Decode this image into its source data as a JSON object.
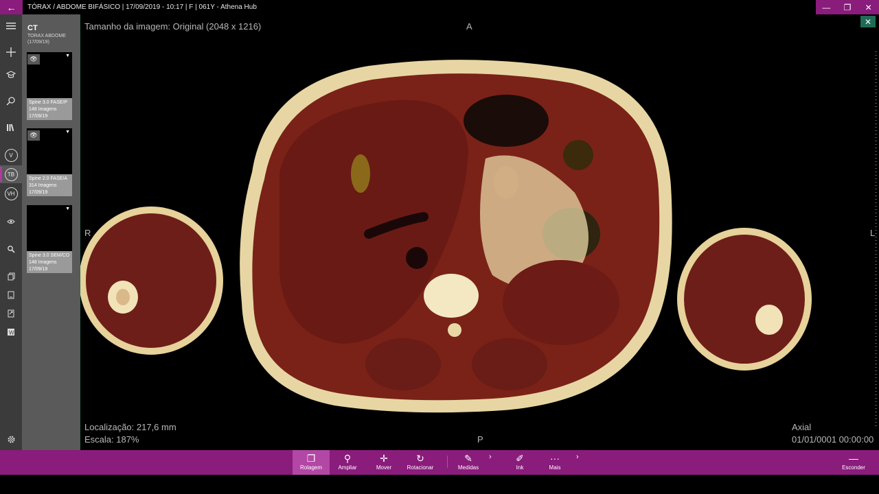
{
  "window": {
    "title": "TÓRAX / ABDOME BIFÁSICO | 17/09/2019 - 10:17 | F | 061Y - Athena Hub",
    "back_icon": "arrow-left-icon",
    "controls": [
      "—",
      "❐",
      "✕"
    ]
  },
  "rail": {
    "items": [
      "hamburger-icon",
      "plus-icon",
      "graduation-cap-icon",
      "search-icon",
      "library-icon"
    ],
    "badges": [
      "V",
      "TB",
      "VH"
    ],
    "active_badge": "TB",
    "settings_icon": "gear-icon"
  },
  "series_panel": {
    "modality": "CT",
    "study_desc": "TORAX ABDOME (17/09/19)",
    "series": [
      {
        "name": "Spine 3.0 FASE/P",
        "count": "148 Imagens",
        "date": "17/09/19",
        "visible": true
      },
      {
        "name": "Spine 2.0 FASE/A",
        "count": "314 Imagens",
        "date": "17/09/19",
        "visible": true
      },
      {
        "name": "Spine 3.0 SEM/CO",
        "count": "148 Imagens",
        "date": "17/09/19",
        "visible": false
      }
    ]
  },
  "viewer": {
    "image_size": "Tamanho da imagem: Original (2048 x 1216)",
    "orient_top": "A",
    "orient_bottom": "P",
    "orient_left": "R",
    "orient_right": "L",
    "location": "Localização: 217,6 mm",
    "scale": "Escala: 187%",
    "plane": "Axial",
    "datetime": "01/01/0001 00:00:00",
    "close": "✕"
  },
  "toolbar": {
    "tools": [
      {
        "label": "Rolagem",
        "icon": "layers-icon",
        "active": true
      },
      {
        "label": "Ampliar",
        "icon": "magnify-icon",
        "active": false
      },
      {
        "label": "Mover",
        "icon": "move-icon",
        "active": false
      },
      {
        "label": "Rotacionar",
        "icon": "rotate-icon",
        "active": false
      },
      {
        "label": "Medidas",
        "icon": "ruler-icon",
        "active": false
      },
      {
        "label": "Ink",
        "icon": "pen-icon",
        "active": false
      },
      {
        "label": "Mais",
        "icon": "more-icon",
        "active": false
      }
    ],
    "hide_label": "Esconder"
  },
  "colors": {
    "accent": "#8a1c7c",
    "accent_active": "#b347a5",
    "viewer_bg": "#000000"
  }
}
